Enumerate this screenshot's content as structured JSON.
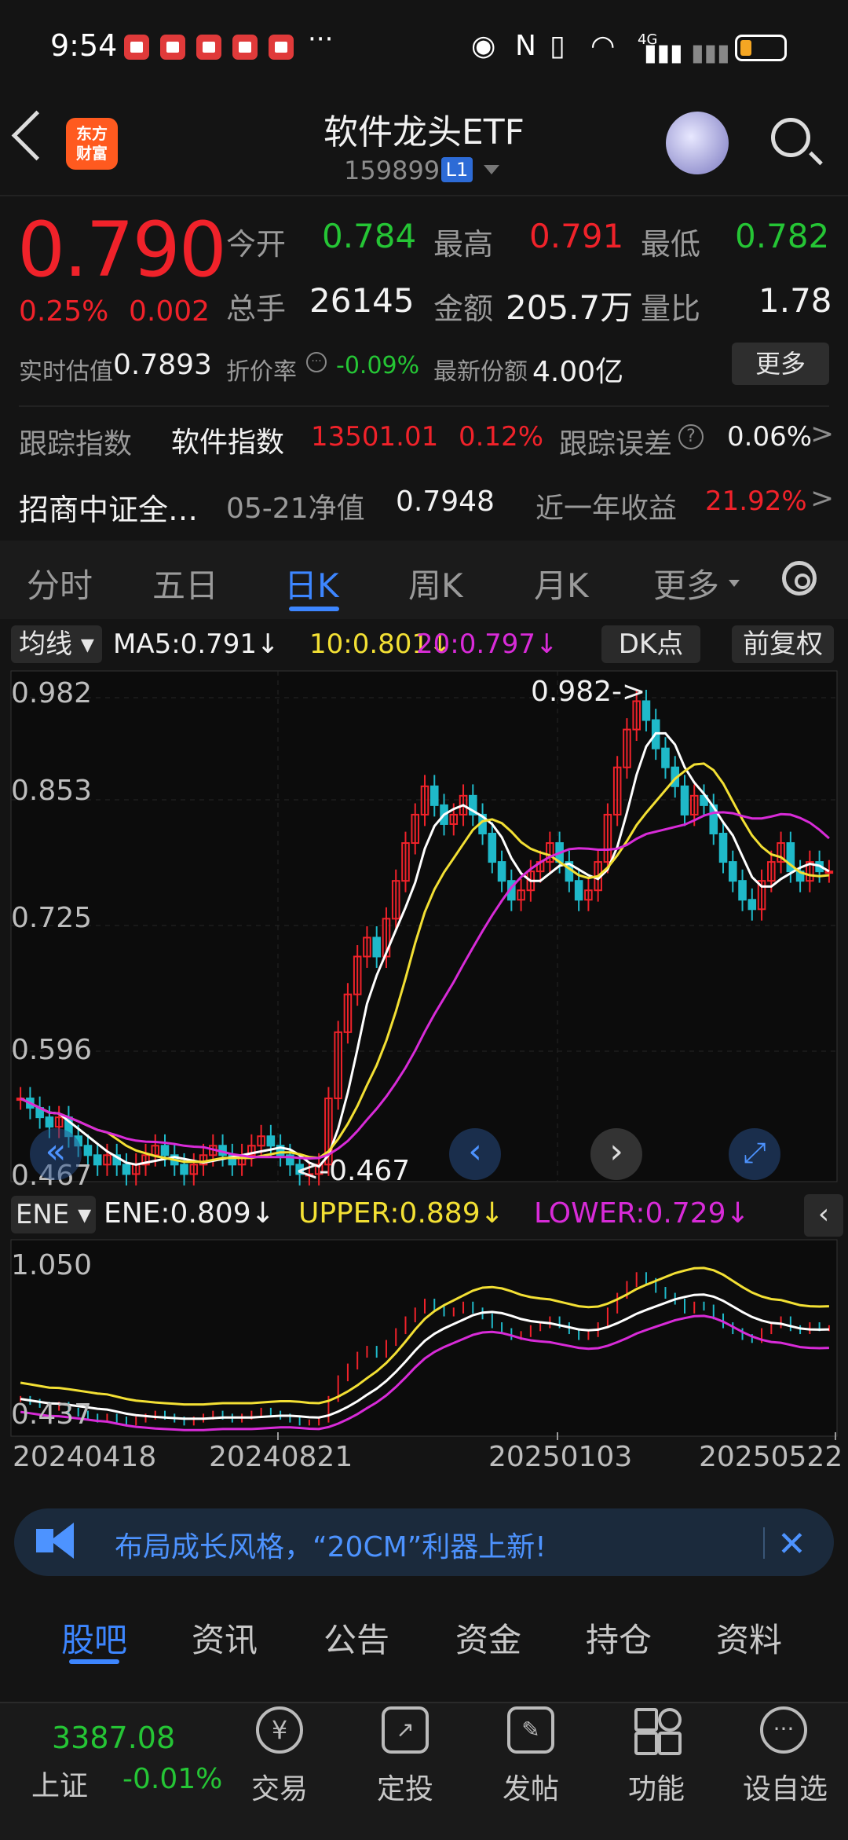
{
  "status_bar": {
    "time": "9:54",
    "more": "···",
    "network": "4G",
    "battery_level": 0.2
  },
  "header": {
    "title": "软件龙头ETF",
    "code": "159899",
    "badge": "L1",
    "logo_line1": "东方",
    "logo_line2": "财富"
  },
  "quote": {
    "price": "0.790",
    "change_pct": "0.25%",
    "change": "0.002",
    "row1": [
      {
        "label": "今开",
        "value": "0.784",
        "color": "green"
      },
      {
        "label": "最高",
        "value": "0.791",
        "color": "red"
      },
      {
        "label": "最低",
        "value": "0.782",
        "color": "green"
      }
    ],
    "row2": [
      {
        "label": "总手",
        "value": "26145",
        "color": "white"
      },
      {
        "label": "金额",
        "value": "205.7万",
        "color": "white"
      },
      {
        "label": "量比",
        "value": "1.78",
        "color": "white"
      }
    ],
    "iopv_label": "实时估值",
    "iopv": "0.7893",
    "premium_label": "折价率",
    "premium": "-0.09%",
    "shares_label": "最新份额",
    "shares": "4.00亿",
    "more": "更多"
  },
  "tracking": {
    "index_label": "跟踪指数",
    "index_name": "软件指数",
    "index_value": "13501.01",
    "index_pct": "0.12%",
    "error_label": "跟踪误差",
    "error_value": "0.06%",
    "fund_name": "招商中证全…",
    "nav_label": "05-21净值",
    "nav_value": "0.7948",
    "yr_label": "近一年收益",
    "yr_value": "21.92%"
  },
  "kline_tabs": [
    "分时",
    "五日",
    "日K",
    "周K",
    "月K",
    "更多"
  ],
  "kline_active": "日K",
  "ma_bar": {
    "selector": "均线",
    "ma5": "MA5:0.791",
    "ma10": "10:0.801",
    "ma20": "20:0.797",
    "dk": "DK点",
    "adjust": "前复权"
  },
  "ene_bar": {
    "selector": "ENE",
    "ene": "ENE:0.809",
    "upper": "UPPER:0.889",
    "lower": "LOWER:0.729"
  },
  "chart_data": {
    "type": "candlestick",
    "price_ticks": [
      "0.982",
      "0.853",
      "0.725",
      "0.596",
      "0.467"
    ],
    "max_label": "0.982->",
    "min_label": "<-0.467",
    "ene_ticks": [
      "1.050",
      "0.437"
    ],
    "x_ticks": [
      "20240418",
      "20240821",
      "20250103",
      "20250522"
    ],
    "close": [
      0.55,
      0.54,
      0.53,
      0.52,
      0.53,
      0.51,
      0.5,
      0.49,
      0.48,
      0.49,
      0.48,
      0.47,
      0.48,
      0.49,
      0.5,
      0.49,
      0.48,
      0.47,
      0.48,
      0.49,
      0.5,
      0.49,
      0.48,
      0.49,
      0.5,
      0.51,
      0.5,
      0.49,
      0.48,
      0.47,
      0.47,
      0.48,
      0.55,
      0.62,
      0.66,
      0.7,
      0.72,
      0.7,
      0.74,
      0.78,
      0.82,
      0.85,
      0.88,
      0.86,
      0.84,
      0.85,
      0.87,
      0.85,
      0.83,
      0.8,
      0.78,
      0.76,
      0.77,
      0.79,
      0.8,
      0.82,
      0.8,
      0.78,
      0.76,
      0.77,
      0.8,
      0.85,
      0.9,
      0.94,
      0.97,
      0.95,
      0.92,
      0.9,
      0.88,
      0.85,
      0.87,
      0.86,
      0.83,
      0.8,
      0.78,
      0.76,
      0.75,
      0.78,
      0.8,
      0.82,
      0.79,
      0.78,
      0.8,
      0.79,
      0.79
    ],
    "colors": {
      "up": "#f0222a",
      "down": "#1fb9c9",
      "ma5": "#ffffff",
      "ma10": "#f3e034",
      "ma20": "#d82bd8",
      "upper": "#f3e034",
      "lower": "#d82bd8",
      "ene": "#ffffff"
    }
  },
  "chart_controls": {
    "prev": "‹",
    "next": "›",
    "fullscreen": "⤢",
    "rewind": "«"
  },
  "banner": {
    "text": "布局成长风格，“20CM”利器上新!",
    "close": "✕"
  },
  "bottom_tabs": [
    "股吧",
    "资讯",
    "公告",
    "资金",
    "持仓",
    "资料"
  ],
  "bottom_tab_active": "股吧",
  "index_ticker": {
    "value": "3387.08",
    "name": "上证",
    "pct": "-0.01%"
  },
  "bottom_nav": [
    "交易",
    "定投",
    "发帖",
    "功能",
    "设自选"
  ]
}
